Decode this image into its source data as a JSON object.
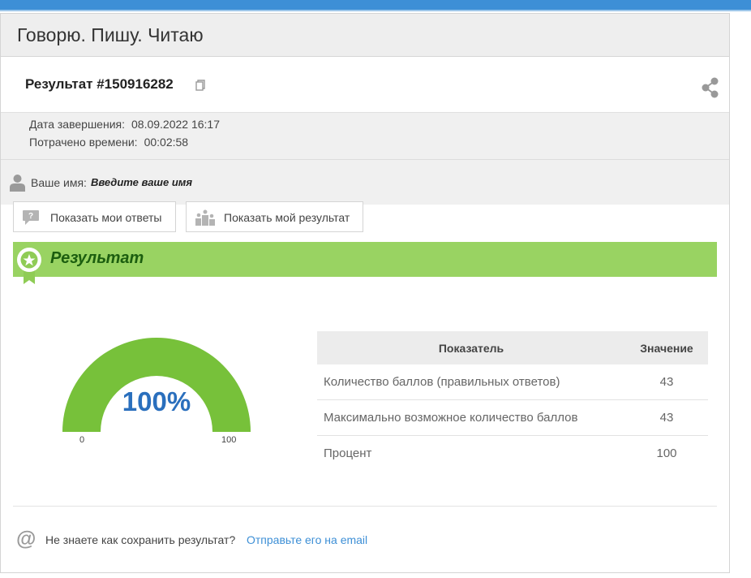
{
  "app": {
    "title": "Говорю. Пишу. Читаю"
  },
  "result": {
    "title": "Результат #150916282",
    "copy_icon": "copy-icon",
    "share_icon": "share-icon"
  },
  "meta": {
    "finished_label": "Дата завершения:",
    "finished_value": "08.09.2022 16:17",
    "spent_label": "Потрачено времени:",
    "spent_value": "00:02:58"
  },
  "user": {
    "icon": "user-icon",
    "label": "Ваше имя:",
    "value": "Введите ваше имя"
  },
  "buttons": {
    "show_answers": "Показать мои ответы",
    "show_answers_icon": "question-bubble-icon",
    "show_result": "Показать мой результат",
    "show_result_icon": "podium-icon"
  },
  "banner": {
    "title": "Результат",
    "icon": "medal-icon",
    "color": "#99d362"
  },
  "gauge": {
    "value": 100,
    "label": "100%",
    "min": "0",
    "max": "100",
    "fill_color": "#77c13a"
  },
  "table": {
    "headers": [
      "Показатель",
      "Значение"
    ],
    "rows": [
      {
        "name": "Количество баллов (правильных ответов)",
        "value": "43"
      },
      {
        "name": "Максимально возможное количество баллов",
        "value": "43"
      },
      {
        "name": "Процент",
        "value": "100"
      }
    ]
  },
  "footer": {
    "icon": "at-icon",
    "text": "Не знаете как сохранить результат?",
    "link": "Отправьте его на email"
  },
  "colors": {
    "accent": "#3d8fd6",
    "header_bg": "#eeeeee"
  }
}
